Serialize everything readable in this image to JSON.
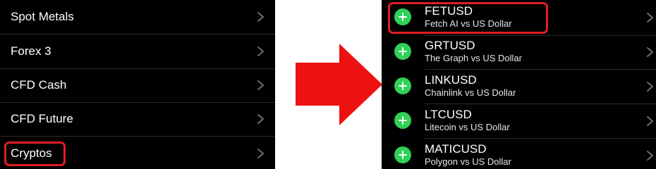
{
  "categories": {
    "items": [
      {
        "label": "Spot Metals"
      },
      {
        "label": "Forex 3"
      },
      {
        "label": "CFD Cash"
      },
      {
        "label": "CFD Future"
      },
      {
        "label": "Cryptos"
      }
    ],
    "highlighted_item": "Cryptos"
  },
  "symbols": {
    "items": [
      {
        "symbol": "FETUSD",
        "description": "Fetch AI vs US Dollar"
      },
      {
        "symbol": "GRTUSD",
        "description": "The Graph vs US Dollar"
      },
      {
        "symbol": "LINKUSD",
        "description": "Chainlink vs US Dollar"
      },
      {
        "symbol": "LTCUSD",
        "description": "Litecoin vs US Dollar"
      },
      {
        "symbol": "MATICUSD",
        "description": "Polygon vs US Dollar"
      }
    ],
    "highlighted_item": "FETUSD"
  },
  "colors": {
    "background": "#000000",
    "text": "#ffffff",
    "add_button": "#30d158",
    "highlight": "#e11d25",
    "arrow": "#ee1111",
    "chevron": "#6e6e73"
  },
  "icons": {
    "arrow": "right-arrow-icon",
    "add": "plus-circle-icon",
    "chevron": "chevron-right-icon"
  }
}
